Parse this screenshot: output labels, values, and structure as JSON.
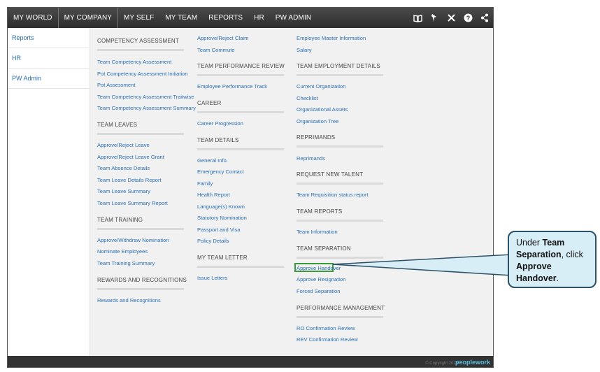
{
  "nav": {
    "items": [
      "MY WORLD",
      "MY COMPANY",
      "MY SELF",
      "MY TEAM",
      "REPORTS",
      "HR",
      "PW ADMIN"
    ],
    "icons": [
      "book-icon",
      "pin-icon",
      "tools-icon",
      "help-icon",
      "share-icon"
    ]
  },
  "sidebar": {
    "items": [
      "Reports",
      "HR",
      "PW Admin"
    ]
  },
  "columns": {
    "col1": {
      "competency": {
        "title": "COMPETENCY ASSESSMENT",
        "links": [
          "Team Competency Assessment",
          "Pot Competency Assessment Initiation",
          "Pot Assessment",
          "Team Competency Assessment Traitwise",
          "Team Competency Assessment Summary"
        ]
      },
      "leaves": {
        "title": "TEAM LEAVES",
        "links": [
          "Approve/Reject Leave",
          "Approve/Reject Leave Grant",
          "Team Absence Details",
          "Team Leave Details Report",
          "Team Leave Summary",
          "Team Leave Summary Report"
        ]
      },
      "training": {
        "title": "TEAM TRAINING",
        "links": [
          "Approve/Withdraw Nomination",
          "Nominate Employees",
          "Team Training Summary"
        ]
      },
      "rewards": {
        "title": "REWARDS AND RECOGNITIONS",
        "links": [
          "Rewards and Recognitions"
        ]
      }
    },
    "col2": {
      "top": {
        "links": [
          "Approve/Reject Claim",
          "Team Commute"
        ]
      },
      "review": {
        "title": "TEAM PERFORMANCE REVIEW",
        "links": [
          "Employee Performance Track"
        ]
      },
      "career": {
        "title": "CAREER",
        "links": [
          "Career Progression"
        ]
      },
      "details": {
        "title": "TEAM DETAILS",
        "links": [
          "General Info.",
          "Emergency Contact",
          "Family",
          "Health Report",
          "Language(s) Known",
          "Statutory Nomination",
          "Passport and Visa",
          "Policy Details"
        ]
      },
      "letter": {
        "title": "MY TEAM LETTER",
        "links": [
          "Issue Letters"
        ]
      }
    },
    "col3": {
      "top": {
        "links": [
          "Employee Master Information",
          "Salary"
        ]
      },
      "employment": {
        "title": "TEAM EMPLOYMENT DETAILS",
        "links": [
          "Current Organization",
          "Checklist",
          "Organizational Assets",
          "Organization Tree"
        ]
      },
      "reprimands": {
        "title": "REPRIMANDS",
        "links": [
          "Reprimands"
        ]
      },
      "talent": {
        "title": "REQUEST NEW TALENT",
        "links": [
          "Team Requisition status report"
        ]
      },
      "reports": {
        "title": "TEAM REPORTS",
        "links": [
          "Team Information"
        ]
      },
      "separation": {
        "title": "TEAM SEPARATION",
        "links": [
          "Approve Handover",
          "Approve Resignation",
          "Forced Separation"
        ]
      },
      "performance": {
        "title": "PERFORMANCE MANAGEMENT",
        "links": [
          "RO Confirmation Review",
          "REV Confirmation Review"
        ]
      }
    }
  },
  "footer": {
    "copyright": "© Copyright 2015",
    "brand": "peoplework"
  },
  "callout": {
    "prefix": "Under ",
    "bold1": "Team Separation",
    "middle": ", click ",
    "bold2": "Approve Handover",
    "suffix": "."
  },
  "colors": {
    "link": "#2a6fb5",
    "highlight": "#3a9a3a",
    "callout_bg": "#d8eef7",
    "callout_border": "#2c5166"
  }
}
